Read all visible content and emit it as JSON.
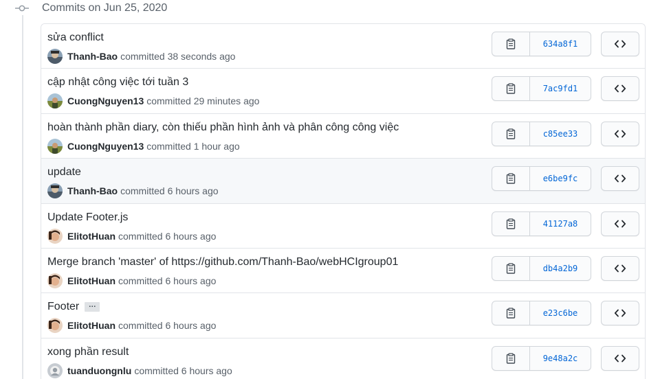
{
  "group": {
    "title": "Commits on Jun 25, 2020"
  },
  "commits": [
    {
      "message": "sửa conflict",
      "author": "Thanh-Bao",
      "verb": "committed",
      "time": "38 seconds ago",
      "sha": "634a8f1",
      "avatar": "thanh-bao"
    },
    {
      "message": "cập nhật công việc tới tuần 3",
      "author": "CuongNguyen13",
      "verb": "committed",
      "time": "29 minutes ago",
      "sha": "7ac9fd1",
      "avatar": "cuong"
    },
    {
      "message": "hoàn thành phần diary, còn thiếu phần hình ảnh và phân công công việc",
      "author": "CuongNguyen13",
      "verb": "committed",
      "time": "1 hour ago",
      "sha": "c85ee33",
      "avatar": "cuong"
    },
    {
      "message": "update",
      "author": "Thanh-Bao",
      "verb": "committed",
      "time": "6 hours ago",
      "sha": "e6be9fc",
      "avatar": "thanh-bao"
    },
    {
      "message": "Update Footer.js",
      "author": "ElitotHuan",
      "verb": "committed",
      "time": "6 hours ago",
      "sha": "41127a8",
      "avatar": "huan"
    },
    {
      "message": "Merge branch 'master' of https://github.com/Thanh-Bao/webHCIgroup01",
      "author": "ElitotHuan",
      "verb": "committed",
      "time": "6 hours ago",
      "sha": "db4a2b9",
      "avatar": "huan"
    },
    {
      "message": "Footer",
      "author": "ElitotHuan",
      "verb": "committed",
      "time": "6 hours ago",
      "sha": "e23c6be",
      "avatar": "huan",
      "has_more": true,
      "more_label": "…"
    },
    {
      "message": "xong phần result",
      "author": "tuanduongnlu",
      "verb": "committed",
      "time": "6 hours ago",
      "sha": "9e48a2c",
      "avatar": "default"
    }
  ],
  "colors": {
    "link": "#0366d6",
    "border": "#e1e4e8",
    "muted": "#586069",
    "hover_row": "#f6f8fa"
  },
  "icons": {
    "copy": "clipboard-icon",
    "browse": "code-icon",
    "timeline": "git-commit-icon"
  }
}
